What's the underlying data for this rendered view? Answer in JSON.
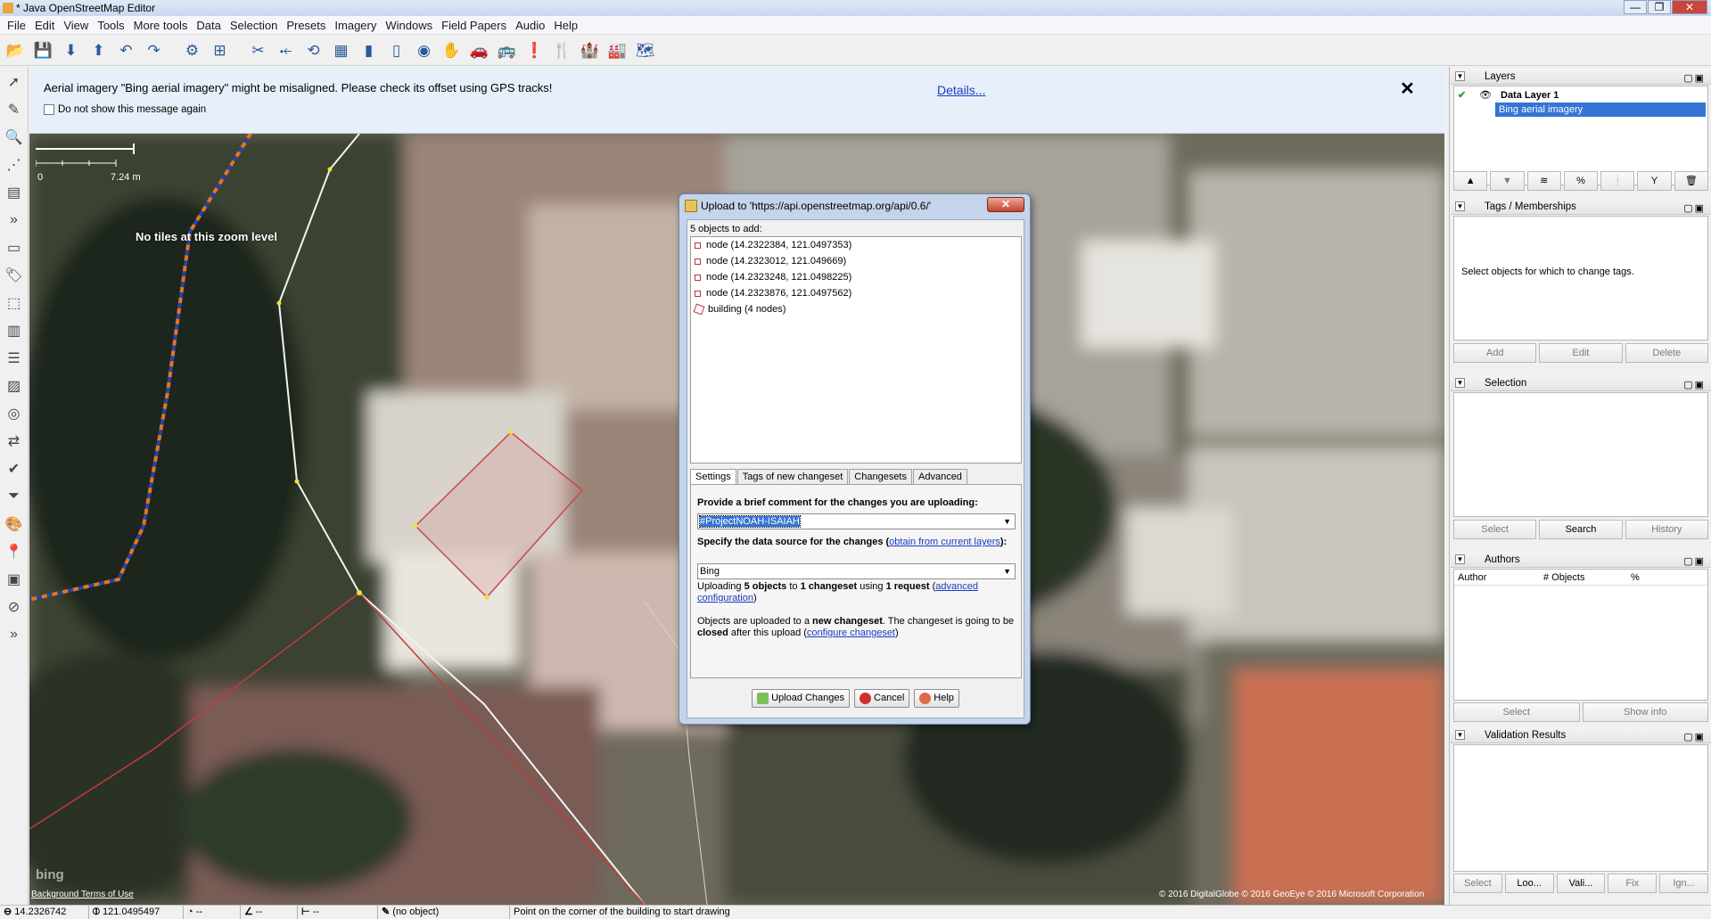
{
  "window": {
    "title": "* Java OpenStreetMap Editor",
    "controls": [
      "—",
      "❐",
      "✕"
    ]
  },
  "menu": [
    "File",
    "Edit",
    "View",
    "Tools",
    "More tools",
    "Data",
    "Selection",
    "Presets",
    "Imagery",
    "Windows",
    "Field Papers",
    "Audio",
    "Help"
  ],
  "notification": {
    "message": "Aerial imagery \"Bing aerial imagery\" might be misaligned. Please check its offset using GPS tracks!",
    "checkbox": "Do not show this message again",
    "details": "Details...",
    "close": "✕"
  },
  "map": {
    "scale_start": "0",
    "scale_end": "7.24 m",
    "no_tiles": "No tiles at this zoom level",
    "bing": "bing",
    "background_links": "Background Terms of Use",
    "copyright": "© 2016 DigitalGlobe © 2016 GeoEye © 2016 Microsoft Corporation"
  },
  "dialog": {
    "title": "Upload to 'https://api.openstreetmap.org/api/0.6/'",
    "close": "✕",
    "objects_label": "5 objects to add:",
    "objects": [
      "node (14.2322384, 121.0497353)",
      "node (14.2323012, 121.049669)",
      "node (14.2323248, 121.0498225)",
      "node (14.2323876, 121.0497562)"
    ],
    "building": "building (4 nodes)",
    "tabs": [
      "Settings",
      "Tags of new changeset",
      "Changesets",
      "Advanced"
    ],
    "comment_label": "Provide a brief comment for the changes you are uploading:",
    "comment_value": "#ProjectNOAH-ISAIAH",
    "source_label_pre": "Specify the data source for the changes (",
    "source_link": "obtain from current layers",
    "source_label_post": "):",
    "source_value": "Bing",
    "upload_info_1": "Uploading ",
    "upload_info_2": "5 objects",
    "upload_info_3": " to ",
    "upload_info_4": "1 changeset",
    "upload_info_5": " using ",
    "upload_info_6": "1 request",
    "upload_info_7": " (",
    "upload_info_link": "advanced configuration",
    "upload_info_8": ")",
    "changeset_info_1": "Objects are uploaded to a ",
    "changeset_info_2": "new changeset",
    "changeset_info_3": ". The changeset is going to be ",
    "changeset_info_4": "closed",
    "changeset_info_5": " after this upload (",
    "changeset_info_link": "configure changeset",
    "changeset_info_6": ")",
    "buttons": {
      "upload": "Upload Changes",
      "cancel": "Cancel",
      "help": "Help"
    }
  },
  "panels": {
    "layers": {
      "title": "Layers",
      "items": [
        {
          "name": "Data Layer 1",
          "selected": false
        },
        {
          "name": "Bing aerial imagery",
          "selected": true
        }
      ]
    },
    "tags": {
      "title": "Tags / Memberships",
      "empty": "Select objects for which to change tags.",
      "buttons": [
        "Add",
        "Edit",
        "Delete"
      ]
    },
    "selection": {
      "title": "Selection",
      "buttons": [
        "Select",
        "Search",
        "History"
      ]
    },
    "authors": {
      "title": "Authors",
      "columns": [
        "Author",
        "# Objects",
        "%"
      ],
      "buttons": [
        "Select",
        "Show info"
      ]
    },
    "validation": {
      "title": "Validation Results",
      "buttons": [
        "Select",
        "Loo...",
        "Vali...",
        "Fix",
        "Ign..."
      ]
    }
  },
  "status": {
    "lat": "14.2326742",
    "lon": "121.0495497",
    "heading": "--",
    "angle": "--",
    "distance": "--",
    "object": "(no object)",
    "hint": "Point on the corner of the building to start drawing"
  },
  "colors": {
    "accent": "#3474d4",
    "link": "#1a3cc0",
    "gps_track": "#e8741c",
    "way": "#f0f0f0",
    "building": "#c23a3a"
  }
}
